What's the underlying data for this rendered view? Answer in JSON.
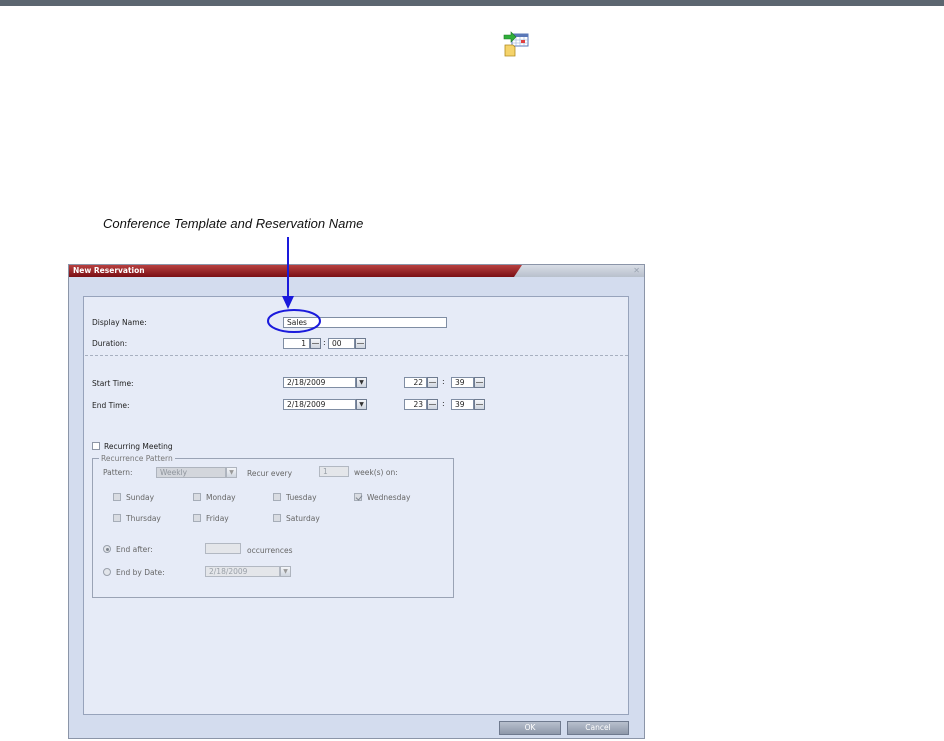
{
  "callout": {
    "label": "Conference Template and Reservation Name"
  },
  "dialog": {
    "title": "New Reservation",
    "fields": {
      "display_name_label": "Display Name:",
      "display_name_value": "Sales",
      "duration_label": "Duration:",
      "duration_hours": "1",
      "duration_minutes": "00",
      "start_time_label": "Start Time:",
      "start_date": "2/18/2009",
      "start_hour": "22",
      "start_minute": "39",
      "end_time_label": "End Time:",
      "end_date": "2/18/2009",
      "end_hour": "23",
      "end_minute": "39",
      "time_separator": ":"
    },
    "recurring": {
      "label": "Recurring Meeting",
      "checked": false
    },
    "recurrence_pattern": {
      "legend": "Recurrence Pattern",
      "pattern_label": "Pattern:",
      "pattern_value": "Weekly",
      "recur_every_label": "Recur every",
      "recur_every_value": "1",
      "weeks_on_label": "week(s) on:",
      "days": [
        {
          "label": "Sunday",
          "checked": false
        },
        {
          "label": "Monday",
          "checked": false
        },
        {
          "label": "Tuesday",
          "checked": false
        },
        {
          "label": "Wednesday",
          "checked": true
        },
        {
          "label": "Thursday",
          "checked": false
        },
        {
          "label": "Friday",
          "checked": false
        },
        {
          "label": "Saturday",
          "checked": false
        }
      ],
      "end_after_label": "End after:",
      "end_after_value": "",
      "occurrences_label": "occurrences",
      "end_by_date_label": "End by Date:",
      "end_by_date_value": "2/18/2009"
    },
    "buttons": {
      "ok": "OK",
      "cancel": "Cancel"
    }
  },
  "colors": {
    "title_bar": "#8b1a1f",
    "dialog_bg": "#d3dcee",
    "panel_bg": "#e6ebf7",
    "callout_blue": "#1a1adc",
    "top_bar": "#5c6670"
  }
}
